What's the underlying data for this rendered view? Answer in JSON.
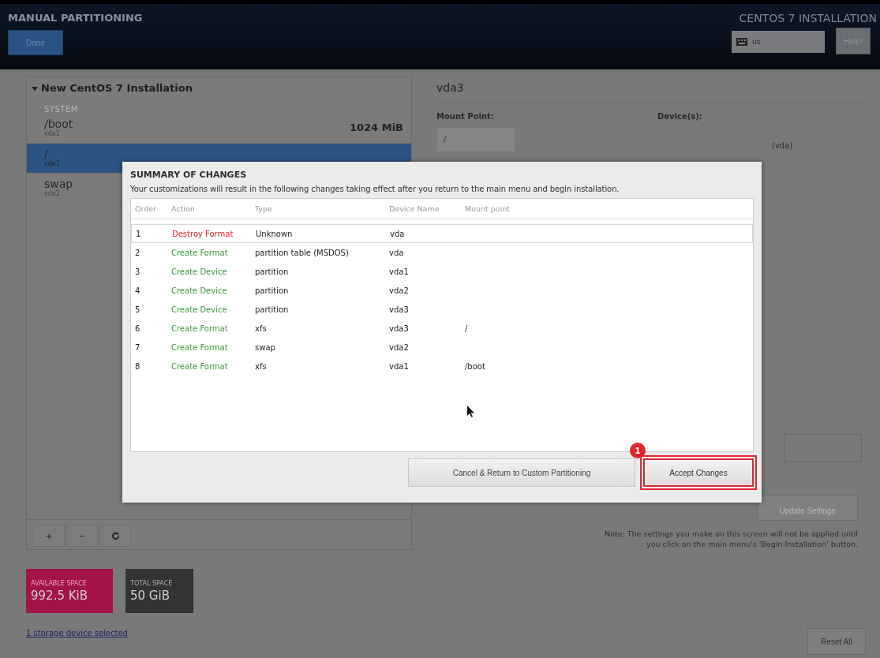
{
  "header": {
    "title": "MANUAL PARTITIONING",
    "done_button": "Done",
    "product": "CENTOS 7 INSTALLATION",
    "keyboard": "us",
    "help_button": "Help!"
  },
  "left_panel": {
    "heading": "New CentOS 7 Installation",
    "expanded": true,
    "section": "SYSTEM",
    "mounts": [
      {
        "name": "/boot",
        "device": "vda1",
        "size": "1024 MiB",
        "selected": false
      },
      {
        "name": "/",
        "device": "vda3",
        "selected": true
      },
      {
        "name": "swap",
        "device": "vda2",
        "selected": false
      }
    ],
    "toolbar": [
      "+",
      "−"
    ]
  },
  "space": {
    "available_label": "AVAILABLE SPACE",
    "available": "992.5 KiB",
    "total_label": "TOTAL SPACE",
    "total": "50 GiB"
  },
  "storage_link": "1 storage device selected",
  "right_panel": {
    "title": "vda3",
    "mount_point_label": "Mount Point:",
    "mount_point": "/",
    "devices_label": "Device(s):",
    "device_fragment": "(vda)",
    "update_button": "Update Settings",
    "note": "Note:  The settings you make on this screen will not be applied until you click on the main menu's 'Begin Installation' button.",
    "reset_button": "Reset All"
  },
  "dialog": {
    "title": "SUMMARY OF CHANGES",
    "message": "Your customizations will result in the following changes taking effect after you return to the main menu and begin installation.",
    "columns": [
      "Order",
      "Action",
      "Type",
      "Device Name",
      "Mount point"
    ],
    "rows": [
      {
        "order": "1",
        "action": "Destroy Format",
        "kind": "destroy",
        "type": "Unknown",
        "device": "vda",
        "mount": "",
        "selected": true
      },
      {
        "order": "2",
        "action": "Create Format",
        "kind": "create",
        "type": "partition table (MSDOS)",
        "device": "vda",
        "mount": "",
        "selected": false
      },
      {
        "order": "3",
        "action": "Create Device",
        "kind": "create",
        "type": "partition",
        "device": "vda1",
        "mount": "",
        "selected": false
      },
      {
        "order": "4",
        "action": "Create Device",
        "kind": "create",
        "type": "partition",
        "device": "vda2",
        "mount": "",
        "selected": false
      },
      {
        "order": "5",
        "action": "Create Device",
        "kind": "create",
        "type": "partition",
        "device": "vda3",
        "mount": "",
        "selected": false
      },
      {
        "order": "6",
        "action": "Create Format",
        "kind": "create",
        "type": "xfs",
        "device": "vda3",
        "mount": "/",
        "selected": false
      },
      {
        "order": "7",
        "action": "Create Format",
        "kind": "create",
        "type": "swap",
        "device": "vda2",
        "mount": "",
        "selected": false
      },
      {
        "order": "8",
        "action": "Create Format",
        "kind": "create",
        "type": "xfs",
        "device": "vda1",
        "mount": "/boot",
        "selected": false
      }
    ],
    "cancel_button": "Cancel & Return to Custom Partitioning",
    "accept_button": "Accept Changes",
    "accept_highlighted": true,
    "step_marker": "1"
  }
}
